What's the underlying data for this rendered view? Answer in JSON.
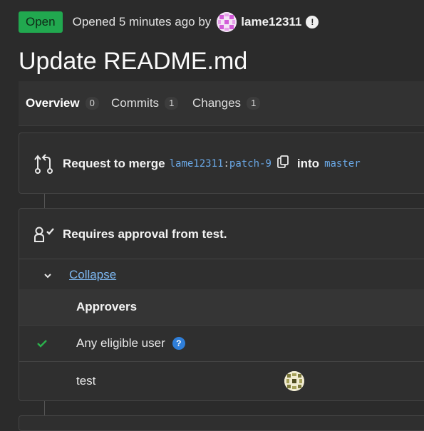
{
  "header": {
    "status": "Open",
    "opened_text": "Opened 5 minutes ago by",
    "username": "lame12311",
    "admin_badge": "!",
    "title": "Update README.md"
  },
  "tabs": [
    {
      "label": "Overview",
      "count": "0"
    },
    {
      "label": "Commits",
      "count": "1"
    },
    {
      "label": "Changes",
      "count": "1"
    }
  ],
  "merge": {
    "prefix": "Request to merge",
    "source_user": "lame12311",
    "separator": ":",
    "source_branch": "patch-9",
    "into": "into",
    "target_branch": "master"
  },
  "approval": {
    "title": "Requires approval from test.",
    "collapse_label": "Collapse",
    "column_header": "Approvers",
    "rows": [
      {
        "label": "Any eligible user",
        "help": "?"
      },
      {
        "label": "test"
      }
    ]
  },
  "colors": {
    "open_badge": "#21a84f",
    "link": "#7db7f0",
    "branch": "#6aa8e6",
    "check": "#2bb24c",
    "help": "#2f7ed8"
  },
  "icons": [
    "user-avatar",
    "admin-badge-icon",
    "merge-request-icon",
    "copy-icon",
    "approval-icon",
    "chevron-down-icon",
    "check-icon",
    "help-icon",
    "approver-avatar"
  ]
}
